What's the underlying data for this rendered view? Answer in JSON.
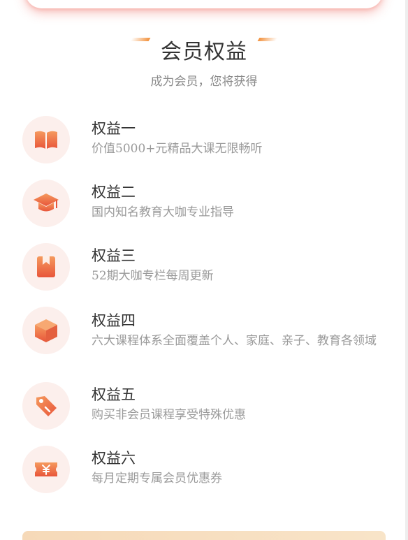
{
  "header": {
    "title": "会员权益",
    "subtitle": "成为会员，您将获得"
  },
  "benefits": [
    {
      "title": "权益一",
      "desc": "价值5000+元精品大课无限畅听",
      "icon": "book-icon"
    },
    {
      "title": "权益二",
      "desc": "国内知名教育大咖专业指导",
      "icon": "graduation-cap-icon"
    },
    {
      "title": "权益三",
      "desc": "52期大咖专栏每周更新",
      "icon": "bookmark-book-icon"
    },
    {
      "title": "权益四",
      "desc": "六大课程体系全面覆盖个人、家庭、亲子、教育各领域",
      "icon": "cube-icon"
    },
    {
      "title": "权益五",
      "desc": "购买非会员课程享受特殊优惠",
      "icon": "price-tag-icon"
    },
    {
      "title": "权益六",
      "desc": "每月定期专属会员优惠券",
      "icon": "coupon-icon"
    }
  ],
  "colors": {
    "accent_orange": "#f2913c",
    "icon_gradient_start": "#f48a52",
    "icon_gradient_end": "#e8553a",
    "icon_bg": "#fcefec"
  }
}
